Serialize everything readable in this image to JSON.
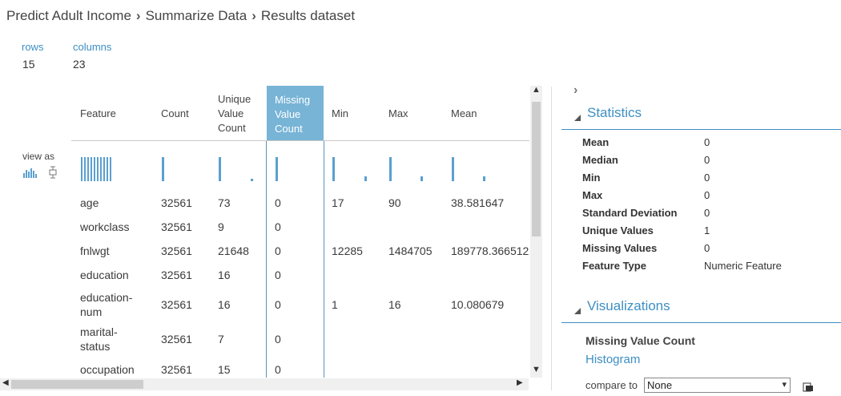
{
  "breadcrumb": {
    "items": [
      "Predict Adult Income",
      "Summarize Data",
      "Results dataset"
    ],
    "separator": "›"
  },
  "meta": {
    "rows_label": "rows",
    "rows_value": "15",
    "columns_label": "columns",
    "columns_value": "23"
  },
  "view_as_label": "view as",
  "table": {
    "headers": [
      "Feature",
      "Count",
      "Unique Value Count",
      "Missing Value Count",
      "Min",
      "Max",
      "Mean"
    ],
    "header_lines": {
      "unique": [
        "Unique",
        "Value",
        "Count"
      ],
      "missing": [
        "Missing",
        "Value",
        "Count"
      ]
    },
    "rows": [
      {
        "feature": "age",
        "count": "32561",
        "unique": "73",
        "missing": "0",
        "min": "17",
        "max": "90",
        "mean": "38.581647"
      },
      {
        "feature": "workclass",
        "count": "32561",
        "unique": "9",
        "missing": "0",
        "min": "",
        "max": "",
        "mean": ""
      },
      {
        "feature": "fnlwgt",
        "count": "32561",
        "unique": "21648",
        "missing": "0",
        "min": "12285",
        "max": "1484705",
        "mean": "189778.366512"
      },
      {
        "feature": "education",
        "count": "32561",
        "unique": "16",
        "missing": "0",
        "min": "",
        "max": "",
        "mean": ""
      },
      {
        "feature_lines": [
          "education-",
          "num"
        ],
        "feature": "education-num",
        "count": "32561",
        "unique": "16",
        "missing": "0",
        "min": "1",
        "max": "16",
        "mean": "10.080679"
      },
      {
        "feature_lines": [
          "marital-",
          "status"
        ],
        "feature": "marital-status",
        "count": "32561",
        "unique": "7",
        "missing": "0",
        "min": "",
        "max": "",
        "mean": ""
      },
      {
        "feature": "occupation",
        "count": "32561",
        "unique": "15",
        "missing": "0",
        "min": "",
        "max": "",
        "mean": ""
      }
    ]
  },
  "statistics": {
    "title": "Statistics",
    "items": [
      {
        "label": "Mean",
        "value": "0"
      },
      {
        "label": "Median",
        "value": "0"
      },
      {
        "label": "Min",
        "value": "0"
      },
      {
        "label": "Max",
        "value": "0"
      },
      {
        "label": "Standard Deviation",
        "value": "0"
      },
      {
        "label": "Unique Values",
        "value": "1"
      },
      {
        "label": "Missing Values",
        "value": "0"
      },
      {
        "label": "Feature Type",
        "value": "Numeric Feature"
      }
    ]
  },
  "visualizations": {
    "title": "Visualizations",
    "subtitle": "Missing Value Count",
    "chart_type": "Histogram",
    "compare_label": "compare to",
    "compare_value": "None"
  },
  "colors": {
    "accent": "#3d8fc4",
    "highlight_header": "#78b4d6",
    "spark": "#5aa0cf"
  }
}
